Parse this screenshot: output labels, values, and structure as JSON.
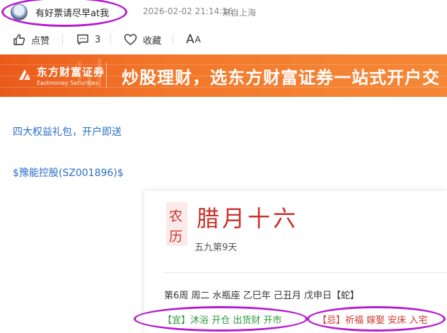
{
  "author": {
    "name": "有好票请尽早at我",
    "time": "2026-02-02 21:14:16",
    "source": "来自上海"
  },
  "actions": {
    "like_label": "点赞",
    "comment_count": "3",
    "favorite_label": "收藏",
    "font_big": "A",
    "font_small": "A"
  },
  "banner": {
    "brand_cn": "东方财富证券",
    "brand_en": "Eastmoney Securities",
    "slogan": "炒股理财，选东方财富证券一站式开户交"
  },
  "links": {
    "gift": "四大权益礼包，开户即送",
    "stock": "$豫能控股(SZ001896)$"
  },
  "calendar": {
    "badge_top": "农",
    "badge_bottom": "历",
    "lunar_date": "腊月十六",
    "sub": "五九第9天",
    "info": "第6周 周二 水瓶座 乙巳年 己丑月 戊申日【蛇】",
    "yi": "【宜】沐浴 开仓 出货财 开市",
    "ji": "【忌】祈福 嫁娶 安床 入宅"
  },
  "colors": {
    "banner": "#f2762a",
    "link": "#2a6ec7",
    "lunar_red": "#c8302a",
    "yi_green": "#2f9a3d",
    "annotation_purple": "#b51bd0"
  }
}
